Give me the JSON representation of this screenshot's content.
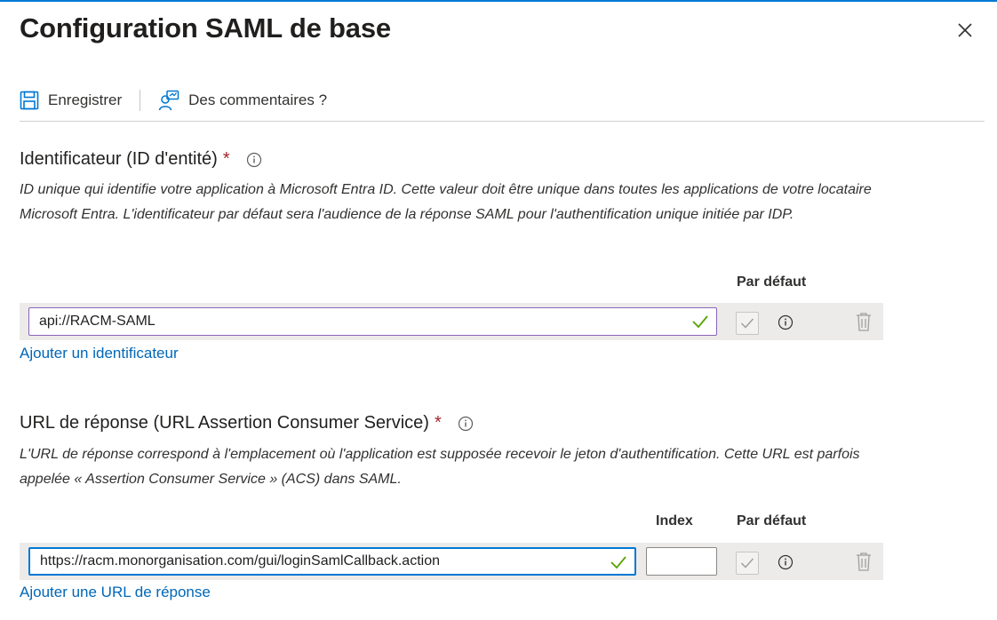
{
  "header": {
    "title": "Configuration SAML de base"
  },
  "toolbar": {
    "save_label": "Enregistrer",
    "feedback_label": "Des commentaires ?"
  },
  "identifier": {
    "title": "Identificateur (ID d'entité)",
    "required_mark": "*",
    "description": "ID unique qui identifie votre application à Microsoft Entra ID. Cette valeur doit être unique dans toutes les applications de votre locataire Microsoft Entra. L'identificateur par défaut sera l'audience de la réponse SAML pour l'authentification unique initiée par IDP.",
    "col_default": "Par défaut",
    "value": "api://RACM-SAML",
    "add_link": "Ajouter un identificateur"
  },
  "reply_url": {
    "title": "URL de réponse (URL Assertion Consumer Service)",
    "required_mark": "*",
    "description": "L'URL de réponse correspond à l'emplacement où l'application est supposée recevoir le jeton d'authentification. Cette URL est parfois appelée « Assertion Consumer Service » (ACS) dans SAML.",
    "col_index": "Index",
    "col_default": "Par défaut",
    "value": "https://racm.monorganisation.com/gui/loginSamlCallback.action",
    "index_value": "",
    "add_link": "Ajouter une URL de réponse"
  },
  "colors": {
    "accent": "#0078d4",
    "link": "#0067b8",
    "required": "#a4262c",
    "valid": "#57a300"
  }
}
